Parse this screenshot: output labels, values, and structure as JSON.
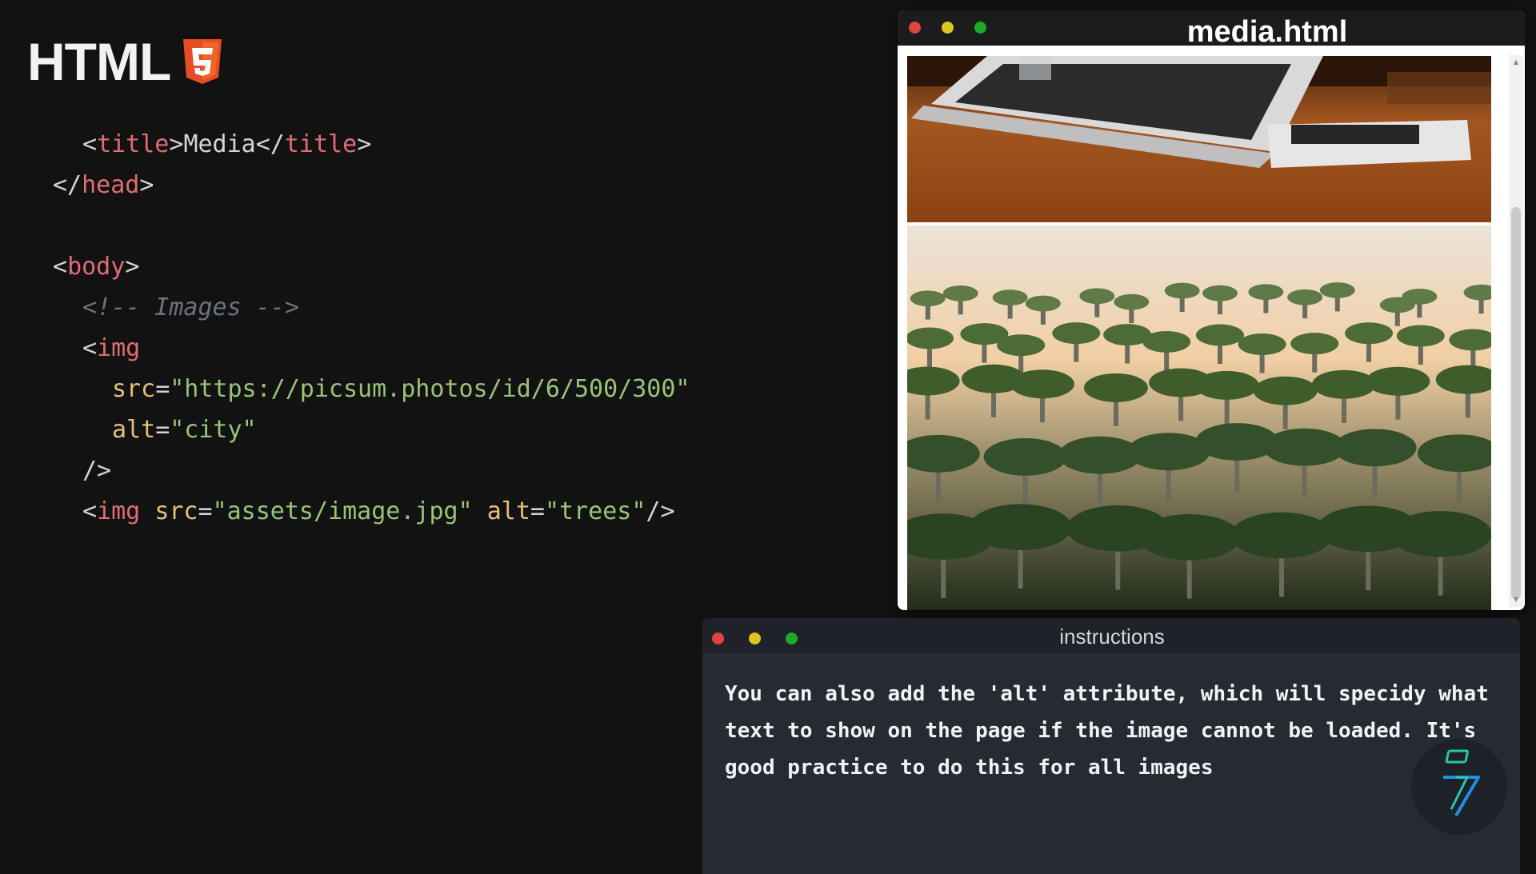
{
  "header": {
    "logo_text": "HTML",
    "logo_badge_glyph": "5",
    "logo_badge_color": "#e44d26"
  },
  "code_lines": [
    [
      {
        "t": "bracket",
        "v": "<"
      },
      {
        "t": "tag",
        "v": "title"
      },
      {
        "t": "bracket",
        "v": ">"
      },
      {
        "t": "text",
        "v": "Media"
      },
      {
        "t": "bracket",
        "v": "</"
      },
      {
        "t": "tag",
        "v": "title"
      },
      {
        "t": "bracket",
        "v": ">"
      }
    ],
    [
      {
        "t": "bracket",
        "v": "</"
      },
      {
        "t": "tag",
        "v": "head"
      },
      {
        "t": "bracket",
        "v": ">"
      }
    ],
    [],
    [
      {
        "t": "bracket",
        "v": "<"
      },
      {
        "t": "tag",
        "v": "body"
      },
      {
        "t": "bracket",
        "v": ">"
      }
    ],
    [
      {
        "t": "comment",
        "v": "<!-- Images -->"
      }
    ],
    [
      {
        "t": "bracket",
        "v": "<"
      },
      {
        "t": "tag",
        "v": "img"
      }
    ],
    [
      {
        "t": "attr",
        "v": "src"
      },
      {
        "t": "bracket",
        "v": "="
      },
      {
        "t": "str",
        "v": "\"https://picsum.photos/id/6/500/300\""
      }
    ],
    [
      {
        "t": "attr",
        "v": "alt"
      },
      {
        "t": "bracket",
        "v": "="
      },
      {
        "t": "str",
        "v": "\"city\""
      }
    ],
    [
      {
        "t": "bracket",
        "v": "/>"
      }
    ],
    [
      {
        "t": "bracket",
        "v": "<"
      },
      {
        "t": "tag",
        "v": "img"
      },
      {
        "t": "text",
        "v": " "
      },
      {
        "t": "attr",
        "v": "src"
      },
      {
        "t": "bracket",
        "v": "="
      },
      {
        "t": "str",
        "v": "\"assets/image.jpg\""
      },
      {
        "t": "text",
        "v": " "
      },
      {
        "t": "attr",
        "v": "alt"
      },
      {
        "t": "bracket",
        "v": "="
      },
      {
        "t": "str",
        "v": "\"trees\""
      },
      {
        "t": "bracket",
        "v": "/>"
      }
    ]
  ],
  "code_indent": [
    1,
    0,
    0,
    0,
    1,
    1,
    2,
    2,
    1,
    1
  ],
  "preview": {
    "title": "media.html",
    "images": [
      {
        "name": "laptop-image"
      },
      {
        "name": "trees-image"
      }
    ]
  },
  "instructions": {
    "title": "instructions",
    "text": "You can also add the 'alt' attribute, which will specidy what text to show on the page if the image cannot be loaded. It's good practice to do this for all images"
  },
  "colors": {
    "tag": "#e06c75",
    "attr": "#e5c07b",
    "string": "#98c379",
    "comment": "#6b7280",
    "brand_accent": "#1fb5c8"
  },
  "icons": {
    "traffic_lights": [
      "close-dot-icon",
      "minimize-dot-icon",
      "maximize-dot-icon"
    ],
    "brand": "brand-bolt-icon",
    "html5": "html5-shield-icon"
  }
}
